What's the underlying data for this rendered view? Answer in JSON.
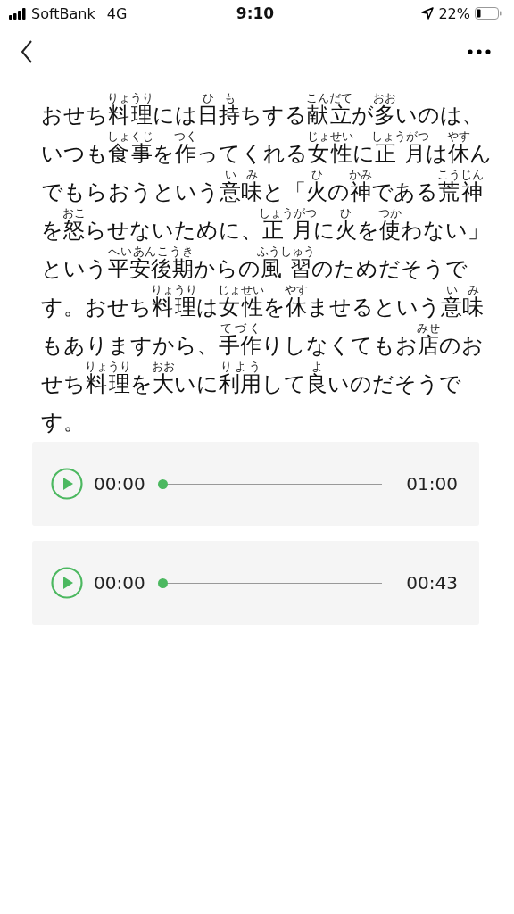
{
  "status_bar": {
    "carrier": "SoftBank",
    "network": "4G",
    "time": "9:10",
    "battery": "22%"
  },
  "article": {
    "lines": [
      [
        {
          "t": "おせち"
        },
        {
          "t": "料理",
          "r": "りょうり"
        },
        {
          "t": "には"
        },
        {
          "t": "日持",
          "r": "ひも"
        },
        {
          "t": "ちする"
        },
        {
          "t": "献立",
          "r": "こんだて"
        },
        {
          "t": "が"
        },
        {
          "t": "多",
          "r": "おお"
        },
        {
          "t": "いのは、"
        }
      ],
      [
        {
          "t": "いつも"
        },
        {
          "t": "食事",
          "r": "しょくじ"
        },
        {
          "t": "を"
        },
        {
          "t": "作",
          "r": "つく"
        },
        {
          "t": "ってくれる"
        },
        {
          "t": "女性",
          "r": "じょせい"
        },
        {
          "t": "に"
        },
        {
          "t": "正月",
          "r": "しょうがつ"
        },
        {
          "t": "は"
        },
        {
          "t": "休",
          "r": "やす"
        },
        {
          "t": "ん"
        }
      ],
      [
        {
          "t": "でもらおうという"
        },
        {
          "t": "意味",
          "r": "いみ"
        },
        {
          "t": "と「"
        },
        {
          "t": "火",
          "r": "ひ"
        },
        {
          "t": "の"
        },
        {
          "t": "神",
          "r": "かみ"
        },
        {
          "t": "である"
        },
        {
          "t": "荒神",
          "r": "こうじん"
        }
      ],
      [
        {
          "t": "を"
        },
        {
          "t": "怒",
          "r": "おこ"
        },
        {
          "t": "らせないために、"
        },
        {
          "t": "正月",
          "r": "しょうがつ"
        },
        {
          "t": "に"
        },
        {
          "t": "火",
          "r": "ひ"
        },
        {
          "t": "を"
        },
        {
          "t": "使",
          "r": "つか"
        },
        {
          "t": "わない」"
        }
      ],
      [
        {
          "t": "という"
        },
        {
          "t": "平安後期",
          "r": "へいあんこうき"
        },
        {
          "t": "からの"
        },
        {
          "t": "風習",
          "r": "ふうしゅう"
        },
        {
          "t": "のためだそうで"
        }
      ],
      [
        {
          "t": "す。おせち"
        },
        {
          "t": "料理",
          "r": "りょうり"
        },
        {
          "t": "は"
        },
        {
          "t": "女性",
          "r": "じょせい"
        },
        {
          "t": "を"
        },
        {
          "t": "休",
          "r": "やす"
        },
        {
          "t": "ませるという"
        },
        {
          "t": "意味",
          "r": "いみ"
        }
      ],
      [
        {
          "t": "もありますから、"
        },
        {
          "t": "手作",
          "r": "てづく"
        },
        {
          "t": "りしなくてもお"
        },
        {
          "t": "店",
          "r": "みせ"
        },
        {
          "t": "のお"
        }
      ],
      [
        {
          "t": "せち"
        },
        {
          "t": "料理",
          "r": "りょうり"
        },
        {
          "t": "を"
        },
        {
          "t": "大",
          "r": "おお"
        },
        {
          "t": "いに"
        },
        {
          "t": "利用",
          "r": "りよう"
        },
        {
          "t": "して"
        },
        {
          "t": "良",
          "r": "よ"
        },
        {
          "t": "いのだそうで"
        }
      ],
      [
        {
          "t": "す。"
        }
      ]
    ]
  },
  "players": [
    {
      "elapsed": "00:00",
      "duration": "01:00",
      "level": 0
    },
    {
      "elapsed": "00:00",
      "duration": "00:43",
      "level": 0
    }
  ]
}
